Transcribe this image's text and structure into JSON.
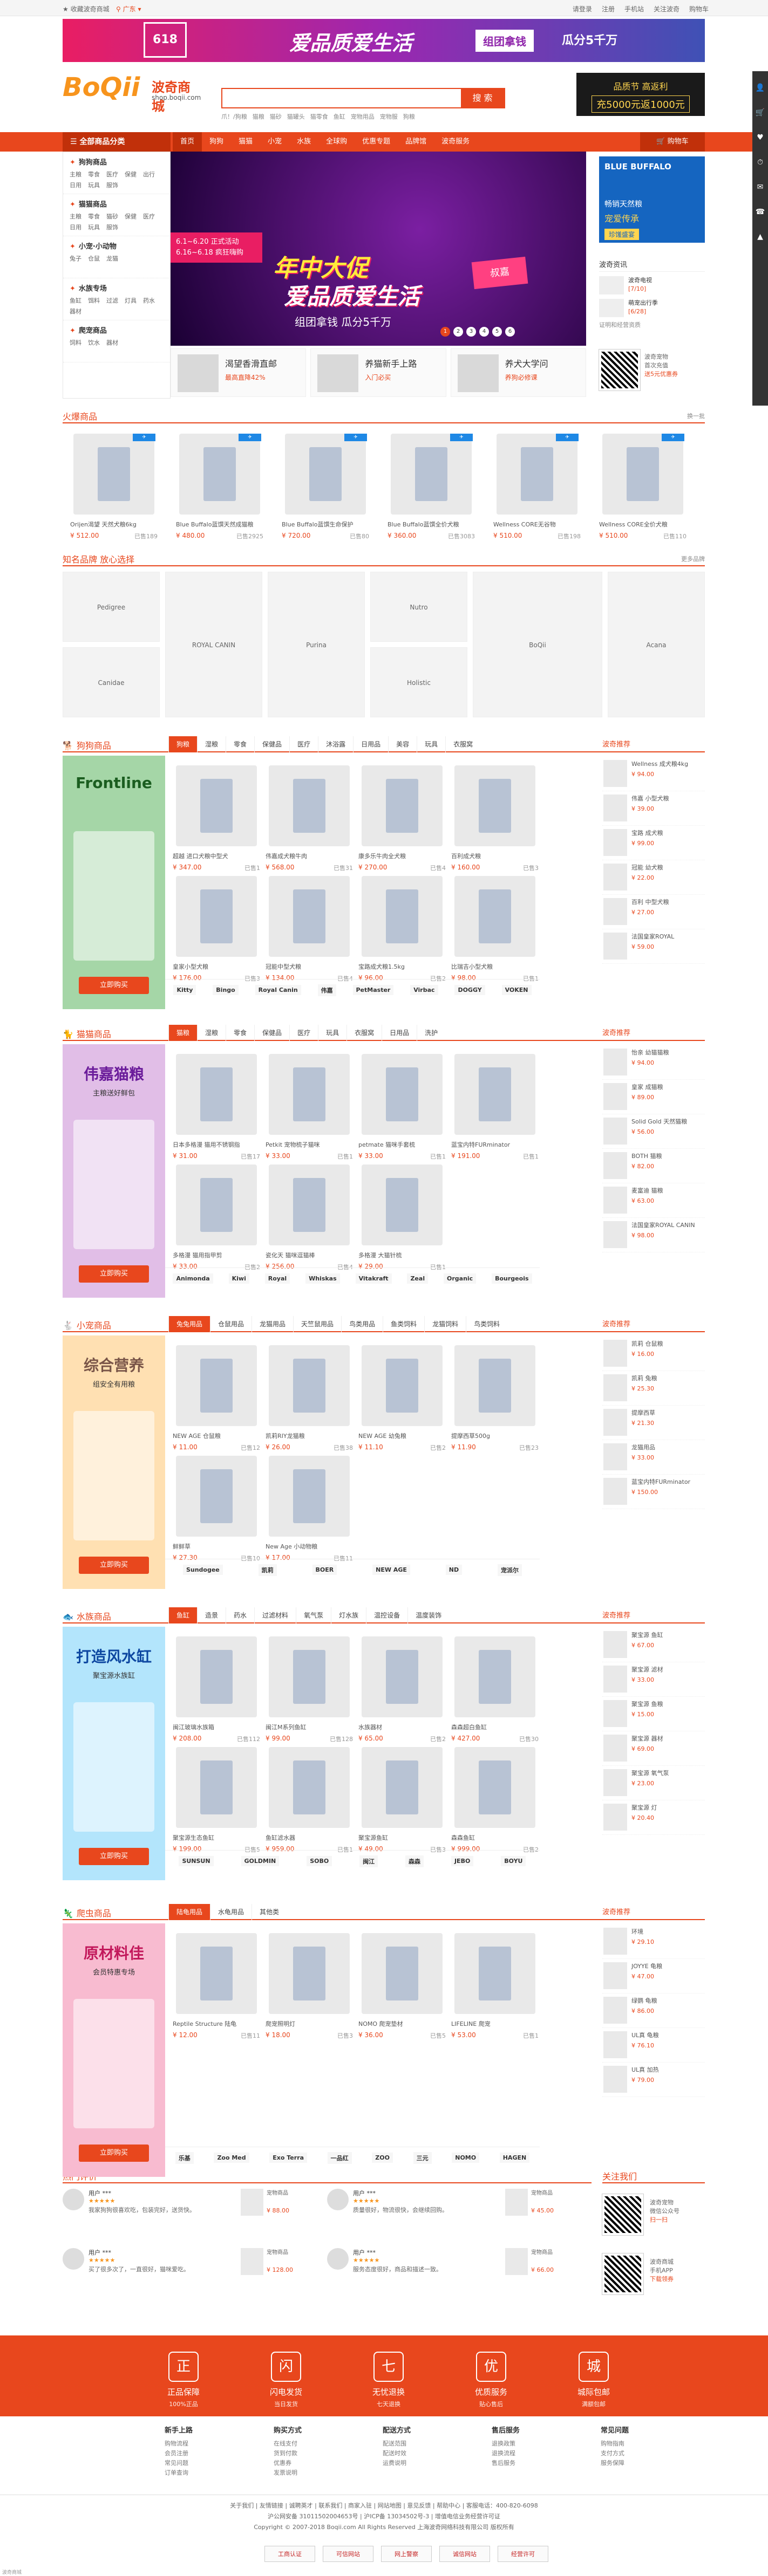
{
  "topbar": {
    "favorite": "收藏波奇商城",
    "location": "广东",
    "links": [
      "请登录",
      "注册",
      "手机站",
      "关注波奇",
      "购物车"
    ]
  },
  "topbanner": {
    "badge": "618",
    "slogan": "爱品质爱生活",
    "tag": "组团拿钱",
    "tag2": "瓜分5千万"
  },
  "header": {
    "logo_en": "BoQii",
    "logo_cn": "波奇商城",
    "logo_url": "shop.boqii.com",
    "search_placeholder": "",
    "search_button": "搜 索",
    "hotwords": [
      "爪！/狗粮",
      "猫粮",
      "猫砂",
      "猫罐头",
      "猫零食",
      "鱼缸",
      "宠物用品",
      "宠物服",
      "狗粮"
    ],
    "promo_a": "品质节 高返利",
    "promo_b": "充5000元返1000元"
  },
  "nav": {
    "all": "全部商品分类",
    "items": [
      "首页",
      "狗狗",
      "猫猫",
      "小宠",
      "水族",
      "全球购",
      "优惠专题",
      "品牌馆",
      "波奇服务"
    ],
    "cart": "购物车"
  },
  "cats": [
    {
      "title": "狗狗商品",
      "subs": [
        "主粮",
        "零食",
        "医疗",
        "保健",
        "出行",
        "日用",
        "玩具",
        "服饰"
      ]
    },
    {
      "title": "猫猫商品",
      "subs": [
        "主粮",
        "零食",
        "猫砂",
        "保健",
        "医疗",
        "日用",
        "玩具",
        "服饰"
      ]
    },
    {
      "title": "小宠·小动物",
      "subs": [
        "兔子",
        "仓鼠",
        "龙猫"
      ]
    },
    {
      "title": "水族专场",
      "subs": [
        "鱼缸",
        "饵料",
        "过滤",
        "灯具",
        "药水",
        "器材"
      ]
    },
    {
      "title": "爬宠商品",
      "subs": [
        "饲料",
        "饮水",
        "器材"
      ]
    }
  ],
  "hero": {
    "dates": "6.1~6.20 正式活动\n6.16~6.18 疯狂嗨购",
    "line1": "年中大促",
    "line2": "爱品质爱生活",
    "line3": "组团拿钱 瓜分5千万",
    "sign": "叔嘉",
    "dots": [
      "1",
      "2",
      "3",
      "4",
      "5",
      "6"
    ]
  },
  "subbanners": [
    {
      "a": "渴望香滑直邮",
      "b": "最高直降42%"
    },
    {
      "a": "养猫新手上路",
      "b": "入门必买"
    },
    {
      "a": "养犬大学问",
      "b": "养狗必修课"
    }
  ],
  "rightad": {
    "brand": "BLUE BUFFALO",
    "sub": "畅销天然粮",
    "title": "宠爱传承",
    "tag": "珍馐盛宴"
  },
  "notice": {
    "title": "波奇资讯",
    "items": [
      {
        "title": "波奇电视",
        "date": "[7/10]"
      },
      {
        "title": "萌宠出行季",
        "date": "[6/28]"
      }
    ],
    "more": "证明和经营资质"
  },
  "qr": {
    "line1": "波奇宠物",
    "line2": "首次充值",
    "line3": "送5元优惠券"
  },
  "sec_hot": {
    "title": "火爆商品",
    "more": "换一批"
  },
  "hot_products": [
    {
      "name": "Orijen渴望 天然犬粮6kg",
      "price": "¥ 512.00",
      "sold": "已售189"
    },
    {
      "name": "Blue Buffalo蓝馔天然成猫粮",
      "price": "¥ 480.00",
      "sold": "已售2925"
    },
    {
      "name": "Blue Buffalo蓝馔生命保护",
      "price": "¥ 720.00",
      "sold": "已售80"
    },
    {
      "name": "Blue Buffalo蓝馔全价犬粮",
      "price": "¥ 360.00",
      "sold": "已售3083"
    },
    {
      "name": "Wellness CORE无谷物",
      "price": "¥ 510.00",
      "sold": "已售198"
    },
    {
      "name": "Wellness CORE全价犬粮",
      "price": "¥ 510.00",
      "sold": "已售110"
    }
  ],
  "sec_brand": {
    "title": "知名品牌 放心选择",
    "more": "更多品牌"
  },
  "brands": [
    "Pedigree",
    "Canidae",
    "ROYAL CANIN",
    "Purina",
    "Nutro",
    "Holistic",
    "BoQii",
    "Acana"
  ],
  "sec_dog": {
    "title": "狗狗商品",
    "tabs": [
      "狗粮",
      "湿粮",
      "零食",
      "保健品",
      "医疗",
      "沐浴露",
      "日用品",
      "美容",
      "玩具",
      "衣服窝"
    ],
    "side": "波奇推荐"
  },
  "dog_products": [
    {
      "name": "超越 进口犬粮中型犬",
      "price": "¥ 347.00",
      "sold": "已售1"
    },
    {
      "name": "伟嘉成犬粮牛肉",
      "price": "¥ 568.00",
      "sold": "已售31"
    },
    {
      "name": "康多乐牛肉全犬粮",
      "price": "¥ 270.00",
      "sold": "已售4"
    },
    {
      "name": "百利成犬粮",
      "price": "¥ 160.00",
      "sold": "已售3"
    },
    {
      "name": "皇家小型犬粮",
      "price": "¥ 176.00",
      "sold": "已售3"
    },
    {
      "name": "冠能中型犬粮",
      "price": "¥ 134.00",
      "sold": "已售4"
    },
    {
      "name": "宝路成犬粮1.5kg",
      "price": "¥ 96.00",
      "sold": "已售2"
    },
    {
      "name": "比瑞吉小型犬粮",
      "price": "¥ 98.00",
      "sold": "已售1"
    }
  ],
  "dog_promo": {
    "t1": "Frontline",
    "t2": "",
    "btn": "立即购买"
  },
  "dog_brands": [
    "Kitty",
    "Bingo",
    "Royal Canin",
    "伟嘉",
    "PetMaster",
    "Virbac",
    "DOGGY",
    "VOKEN"
  ],
  "dog_recs": [
    {
      "name": "Wellness 成犬粮4kg",
      "price": "¥ 94.00"
    },
    {
      "name": "伟嘉 小型犬粮",
      "price": "¥ 39.00"
    },
    {
      "name": "宝路 成犬粮",
      "price": "¥ 99.00"
    },
    {
      "name": "冠能 幼犬粮",
      "price": "¥ 22.00"
    },
    {
      "name": "百利 中型犬粮",
      "price": "¥ 27.00"
    },
    {
      "name": "法国皇家ROYAL",
      "price": "¥ 59.00"
    }
  ],
  "sec_cat": {
    "title": "猫猫商品",
    "tabs": [
      "猫粮",
      "湿粮",
      "零食",
      "保健品",
      "医疗",
      "玩具",
      "衣服窝",
      "日用品",
      "洗护"
    ],
    "side": "波奇推荐"
  },
  "cat_products": [
    {
      "name": "日本多格漫 猫用不锈钢指",
      "price": "¥ 31.00",
      "sold": "已售17"
    },
    {
      "name": "Petkit 宠物梳子猫咪",
      "price": "¥ 33.00",
      "sold": "已售1"
    },
    {
      "name": "petmate 猫咪手套梳",
      "price": "¥ 33.00",
      "sold": "已售1"
    },
    {
      "name": "蓝宝内特FURminator",
      "price": "¥ 191.00",
      "sold": "已售1"
    },
    {
      "name": "多格漫 猫用指甲剪",
      "price": "¥ 33.00",
      "sold": "已售2"
    },
    {
      "name": "瓷化天 猫咪逗猫棒",
      "price": "¥ 256.00",
      "sold": "已售4"
    },
    {
      "name": "多格漫 大猫针梳",
      "price": "¥ 29.00",
      "sold": "已售1"
    }
  ],
  "cat_promo": {
    "t1": "伟嘉猫粮",
    "t2": "主粮送好鲜包",
    "btn": "立即购买"
  },
  "cat_brands": [
    "Animonda",
    "Kiwi",
    "Royal",
    "Whiskas",
    "Vitakraft",
    "Zeal",
    "Organic",
    "Bourgeois"
  ],
  "cat_recs": [
    {
      "name": "怡亲 幼猫猫粮",
      "price": "¥ 94.00"
    },
    {
      "name": "皇家 成猫粮",
      "price": "¥ 89.00"
    },
    {
      "name": "Solid Gold 天然猫粮",
      "price": "¥ 56.00"
    },
    {
      "name": "BOTH 猫粮",
      "price": "¥ 82.00"
    },
    {
      "name": "麦富迪 猫粮",
      "price": "¥ 63.00"
    },
    {
      "name": "法国皇家ROYAL CANIN",
      "price": "¥ 98.00"
    }
  ],
  "sec_small": {
    "title": "小宠商品",
    "tabs": [
      "兔兔用品",
      "仓鼠用品",
      "龙猫用品",
      "天竺鼠用品",
      "鸟类用品",
      "鱼类饲料",
      "龙猫饲料",
      "鸟类饲料"
    ],
    "side": "波奇推荐"
  },
  "small_products": [
    {
      "name": "NEW AGE 仓鼠粮",
      "price": "¥ 11.00",
      "sold": "已售12"
    },
    {
      "name": "凯莉RIY龙猫粮",
      "price": "¥ 26.00",
      "sold": "已售38"
    },
    {
      "name": "NEW AGE 幼兔粮",
      "price": "¥ 11.10",
      "sold": "已售2"
    },
    {
      "name": "提摩西草500g",
      "price": "¥ 11.90",
      "sold": "已售23"
    },
    {
      "name": "鲜鲜草",
      "price": "¥ 27.30",
      "sold": "已售10"
    },
    {
      "name": "New Age 小动物粮",
      "price": "¥ 17.00",
      "sold": "已售11"
    }
  ],
  "small_promo": {
    "t1": "综合营养",
    "t2": "组安全有用粮",
    "btn": "立即购买"
  },
  "small_brands": [
    "Sundogee",
    "凯莉",
    "BOER",
    "NEW AGE",
    "ND",
    "宠派尔"
  ],
  "small_recs": [
    {
      "name": "凯莉 仓鼠粮",
      "price": "¥ 16.00"
    },
    {
      "name": "凯莉 兔粮",
      "price": "¥ 25.30"
    },
    {
      "name": "提摩西草",
      "price": "¥ 21.30"
    },
    {
      "name": "龙猫用品",
      "price": "¥ 33.00"
    },
    {
      "name": "蓝宝内特FURminator",
      "price": "¥ 150.00"
    }
  ],
  "sec_fish": {
    "title": "水族商品",
    "tabs": [
      "鱼缸",
      "造景",
      "药水",
      "过滤材料",
      "氧气泵",
      "灯水族",
      "温控设备",
      "温度装饰"
    ],
    "side": "波奇推荐"
  },
  "fish_products": [
    {
      "name": "闽江玻璃水族箱",
      "price": "¥ 208.00",
      "sold": "已售112"
    },
    {
      "name": "闽江M系列鱼缸",
      "price": "¥ 99.00",
      "sold": "已售128"
    },
    {
      "name": "水族器材",
      "price": "¥ 65.00",
      "sold": "已售2"
    },
    {
      "name": "森森超白鱼缸",
      "price": "¥ 427.00",
      "sold": "已售30"
    },
    {
      "name": "聚宝源生态鱼缸",
      "price": "¥ 199.00",
      "sold": "已售5"
    },
    {
      "name": "鱼缸滤水器",
      "price": "¥ 959.00",
      "sold": "已售1"
    },
    {
      "name": "聚宝源鱼缸",
      "price": "¥ 49.00",
      "sold": "已售3"
    },
    {
      "name": "森森鱼缸",
      "price": "¥ 999.00",
      "sold": "已售2"
    }
  ],
  "fish_promo": {
    "t1": "打造风水缸",
    "t2": "聚宝源水族缸",
    "btn": "立即购买"
  },
  "fish_brands": [
    "SUNSUN",
    "GOLDMIN",
    "SOBO",
    "闽江",
    "森森",
    "JEBO",
    "BOYU"
  ],
  "fish_recs": [
    {
      "name": "聚宝源 鱼缸",
      "price": "¥ 67.00"
    },
    {
      "name": "聚宝源 滤材",
      "price": "¥ 33.00"
    },
    {
      "name": "聚宝源 鱼粮",
      "price": "¥ 15.00"
    },
    {
      "name": "聚宝源 器材",
      "price": "¥ 69.00"
    },
    {
      "name": "聚宝源 氧气泵",
      "price": "¥ 23.00"
    },
    {
      "name": "聚宝源 灯",
      "price": "¥ 20.40"
    }
  ],
  "sec_reptile": {
    "title": "爬虫商品",
    "tabs": [
      "陆龟用品",
      "水龟用品",
      "其他类"
    ],
    "side": "波奇推荐"
  },
  "rep_products": [
    {
      "name": "Reptile Structure 陆龟",
      "price": "¥ 12.00",
      "sold": "已售11"
    },
    {
      "name": "爬宠照明灯",
      "price": "¥ 18.00",
      "sold": "已售3"
    },
    {
      "name": "NOMO 爬宠垫材",
      "price": "¥ 36.00",
      "sold": "已售5"
    },
    {
      "name": "LIFELINE 爬宠",
      "price": "¥ 53.00",
      "sold": "已售1"
    }
  ],
  "rep_promo": {
    "t1": "原材料佳",
    "t2": "会员特惠专场",
    "btn": "立即购买"
  },
  "rep_brands": [
    "乐基",
    "Zoo Med",
    "Exo Terra",
    "一品红",
    "ZOO",
    "三元",
    "NOMO",
    "HAGEN"
  ],
  "rep_recs": [
    {
      "name": "环境",
      "price": "¥ 29.10"
    },
    {
      "name": "JOYYE 龟粮",
      "price": "¥ 47.00"
    },
    {
      "name": "绿鹦 龟粮",
      "price": "¥ 86.00"
    },
    {
      "name": "UL真 龟粮",
      "price": "¥ 76.10"
    },
    {
      "name": "UL真 加热",
      "price": "¥ 79.00"
    }
  ],
  "sec_review": {
    "title": "热门评价"
  },
  "reviews": [
    {
      "user": "用户 ***",
      "stars": "★★★★★",
      "text": "我家狗狗很喜欢吃，包装完好，送货快。",
      "prod": "宠物商品",
      "price": "¥ 88.00"
    },
    {
      "user": "用户 ***",
      "stars": "★★★★★",
      "text": "质量很好，物流很快，会继续回购。",
      "prod": "宠物商品",
      "price": "¥ 45.00"
    },
    {
      "user": "用户 ***",
      "stars": "★★★★★",
      "text": "买了很多次了，一直很好，猫咪爱吃。",
      "prod": "宠物商品",
      "price": "¥ 128.00"
    },
    {
      "user": "用户 ***",
      "stars": "★★★★★",
      "text": "服务态度很好，商品和描述一致。",
      "prod": "宠物商品",
      "price": "¥ 66.00"
    }
  ],
  "follow": {
    "title": "关注我们",
    "r1a": "波奇宠物",
    "r1b": "微信公众号",
    "r1c": "扫一扫",
    "r2a": "波奇商城",
    "r2b": "手机APP",
    "r2c": "下载领券"
  },
  "service": [
    {
      "ic": "正",
      "a": "正品保障",
      "b": "100%正品"
    },
    {
      "ic": "闪",
      "a": "闪电发货",
      "b": "当日发货"
    },
    {
      "ic": "七",
      "a": "无忧退换",
      "b": "七天退换"
    },
    {
      "ic": "优",
      "a": "优质服务",
      "b": "贴心售后"
    },
    {
      "ic": "城",
      "a": "城际包邮",
      "b": "满额包邮"
    }
  ],
  "footcols": [
    {
      "h": "新手上路",
      "l": [
        "购物流程",
        "会员注册",
        "常见问题",
        "订单查询"
      ]
    },
    {
      "h": "购买方式",
      "l": [
        "在线支付",
        "货到付款",
        "优惠券",
        "发票说明"
      ]
    },
    {
      "h": "配送方式",
      "l": [
        "配送范围",
        "配送时效",
        "运费说明"
      ]
    },
    {
      "h": "售后服务",
      "l": [
        "退换政策",
        "退换流程",
        "售后服务"
      ]
    },
    {
      "h": "常见问题",
      "l": [
        "购物指南",
        "支付方式",
        "服务保障"
      ]
    }
  ],
  "footlinks": {
    "line1": "关于我们 | 友情链接 | 诚聘英才 | 联系我们 | 商家入驻 | 网站地图 | 意见反馈 | 帮助中心 | 客服电话：400-820-6098",
    "line2": "沪公网安备 31011502004653号 | 沪ICP备 13034502号-3 | 增值电信业务经营许可证",
    "line3": "Copyright © 2007-2018 Boqii.com All Rights Reserved 上海波奇网络科技有限公司 版权所有"
  },
  "certs": [
    "工商认证",
    "可信网站",
    "网上警察",
    "诚信网站",
    "经营许可"
  ],
  "footnote": "波奇商城"
}
